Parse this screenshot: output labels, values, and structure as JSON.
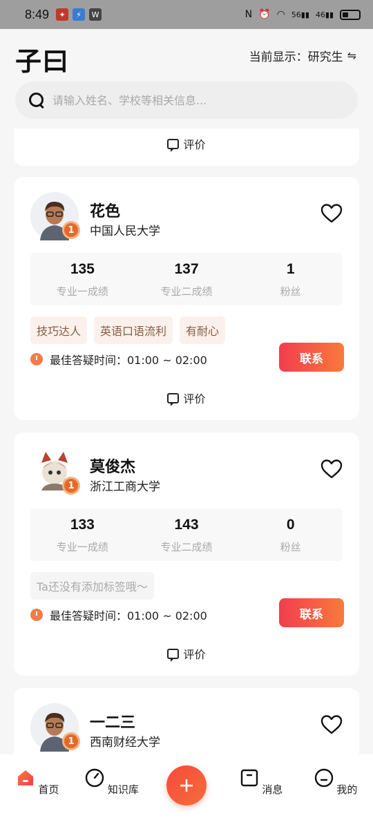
{
  "status_bar": {
    "time": "8:49",
    "net_1": "56",
    "net_2": "46"
  },
  "header": {
    "logo": "子曰",
    "display_label": "当前显示：研究生",
    "swap_icon": "swap-icon"
  },
  "search": {
    "placeholder": "请输入姓名、学校等相关信息..."
  },
  "partial_card": {
    "review_label": "评价"
  },
  "cards": [
    {
      "name": "花色",
      "school": "中国人民大学",
      "medal": "1",
      "stats": [
        {
          "value": "135",
          "label": "专业一成绩"
        },
        {
          "value": "137",
          "label": "专业二成绩"
        },
        {
          "value": "1",
          "label": "粉丝"
        }
      ],
      "tags": [
        "技巧达人",
        "英语口语流利",
        "有耐心"
      ],
      "qa_time": "最佳答疑时间：01:00 ~ 02:00",
      "contact_label": "联系",
      "review_label": "评价"
    },
    {
      "name": "莫俊杰",
      "school": "浙江工商大学",
      "medal": "1",
      "stats": [
        {
          "value": "133",
          "label": "专业一成绩"
        },
        {
          "value": "143",
          "label": "专业二成绩"
        },
        {
          "value": "0",
          "label": "粉丝"
        }
      ],
      "empty_tag": "Ta还没有添加标签哦～",
      "qa_time": "最佳答疑时间：01:00 ~ 02:00",
      "contact_label": "联系",
      "review_label": "评价"
    },
    {
      "name": "一二三",
      "school": "西南财经大学",
      "medal": "1"
    }
  ],
  "bottom_nav": {
    "home": "首页",
    "knowledge": "知识库",
    "add": "+",
    "messages": "消息",
    "mine": "我的"
  },
  "colors": {
    "accent": "#f5503c",
    "tag_bg": "#fbf1ec",
    "tag_text": "#8a5a44"
  }
}
